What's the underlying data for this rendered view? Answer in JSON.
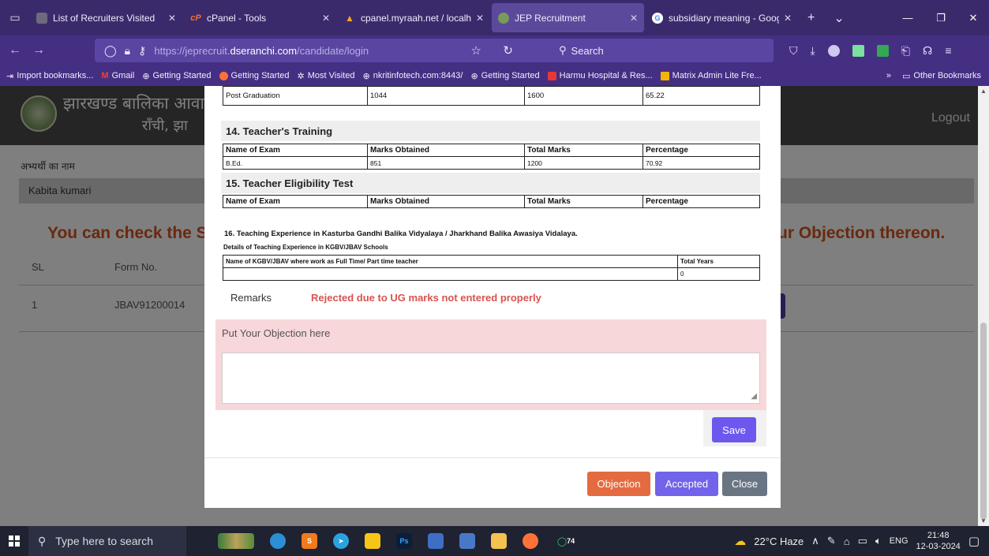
{
  "browser": {
    "tabs": [
      {
        "title": "List of Recruiters Visited",
        "favicon_color": "#6e6a7e"
      },
      {
        "title": "cPanel - Tools",
        "favicon_color": "#ff6c2c"
      },
      {
        "title": "cpanel.myraah.net / localhos",
        "favicon_color": "#f5a623"
      },
      {
        "title": "JEP Recruitment",
        "favicon_color": "#7a9a5a"
      },
      {
        "title": "subsidiary meaning - Google",
        "favicon_color": "#4285f4"
      }
    ],
    "favicon_glyphs": {
      "cpanel": "cP",
      "google": "G"
    },
    "tab_extra": {
      "new_tab": "+",
      "list_tabs": "⌄"
    },
    "window_controls": {
      "minimize": "—",
      "restore": "❐",
      "close": "✕"
    },
    "url": {
      "prefix": "https://jeprecruit.",
      "host": "dseranchi.com",
      "path": "/candidate/login"
    },
    "search_placeholder": "Search",
    "bookmarks": [
      "Import bookmarks...",
      "Gmail",
      "Getting Started",
      "Getting Started",
      "Most Visited",
      "nkritinfotech.com:8443/",
      "Getting Started",
      "Harmu Hospital & Res...",
      "Matrix Admin Lite Fre..."
    ],
    "bookmarks_overflow": "»",
    "other_bookmarks": "Other Bookmarks"
  },
  "site": {
    "title": "झारखण्ड बालिका आवासीय वि",
    "subtitle": "राँची, झा",
    "logout": "Logout"
  },
  "page": {
    "candidate_label": "अभ्यर्थी का नाम",
    "candidate_name": "Kabita kumari",
    "message_left": "You can check the S",
    "message_right": "ur Objection thereon.",
    "table_headers": {
      "sl": "SL",
      "form_no": "Form No."
    },
    "table_row": {
      "sl": "1",
      "form_no": "JBAV91200014"
    }
  },
  "modal": {
    "top_row": {
      "exam": "Post Graduation",
      "obtained": "1044",
      "total": "1600",
      "percentage": "65.22"
    },
    "section14": {
      "title": "14. Teacher's Training",
      "headers": [
        "Name of Exam",
        "Marks Obtained",
        "Total Marks",
        "Percentage"
      ],
      "rows": [
        [
          "B.Ed.",
          "851",
          "1200",
          "70.92"
        ]
      ]
    },
    "section15": {
      "title": "15. Teacher Eligibility Test",
      "headers": [
        "Name of Exam",
        "Marks Obtained",
        "Total Marks",
        "Percentage"
      ]
    },
    "section16": {
      "title": "16. Teaching Experience in Kasturba Gandhi Balika Vidyalaya / Jharkhand Balika Awasiya Vidalaya.",
      "subtitle": "Details of Teaching Experience in KGBV/JBAV Schools",
      "headers": [
        "Name of KGBV/JBAV where work as Full Time/ Part time teacher",
        "Total Years"
      ],
      "row": [
        "",
        "0"
      ]
    },
    "remarks_label": "Remarks",
    "remarks_value": "Rejected due to UG marks not entered properly",
    "objection_label": "Put Your Objection here",
    "objection_value": "",
    "save_label": "Save",
    "footer_buttons": {
      "objection": "Objection",
      "accepted": "Accepted",
      "close": "Close"
    }
  },
  "taskbar": {
    "search_placeholder": "Type here to search",
    "weather": "22°C  Haze",
    "language": "ENG",
    "time": "21:48",
    "date": "12-03-2024",
    "whatsapp_badge": "74",
    "app_labels": {
      "photoshop": "Ps"
    }
  }
}
